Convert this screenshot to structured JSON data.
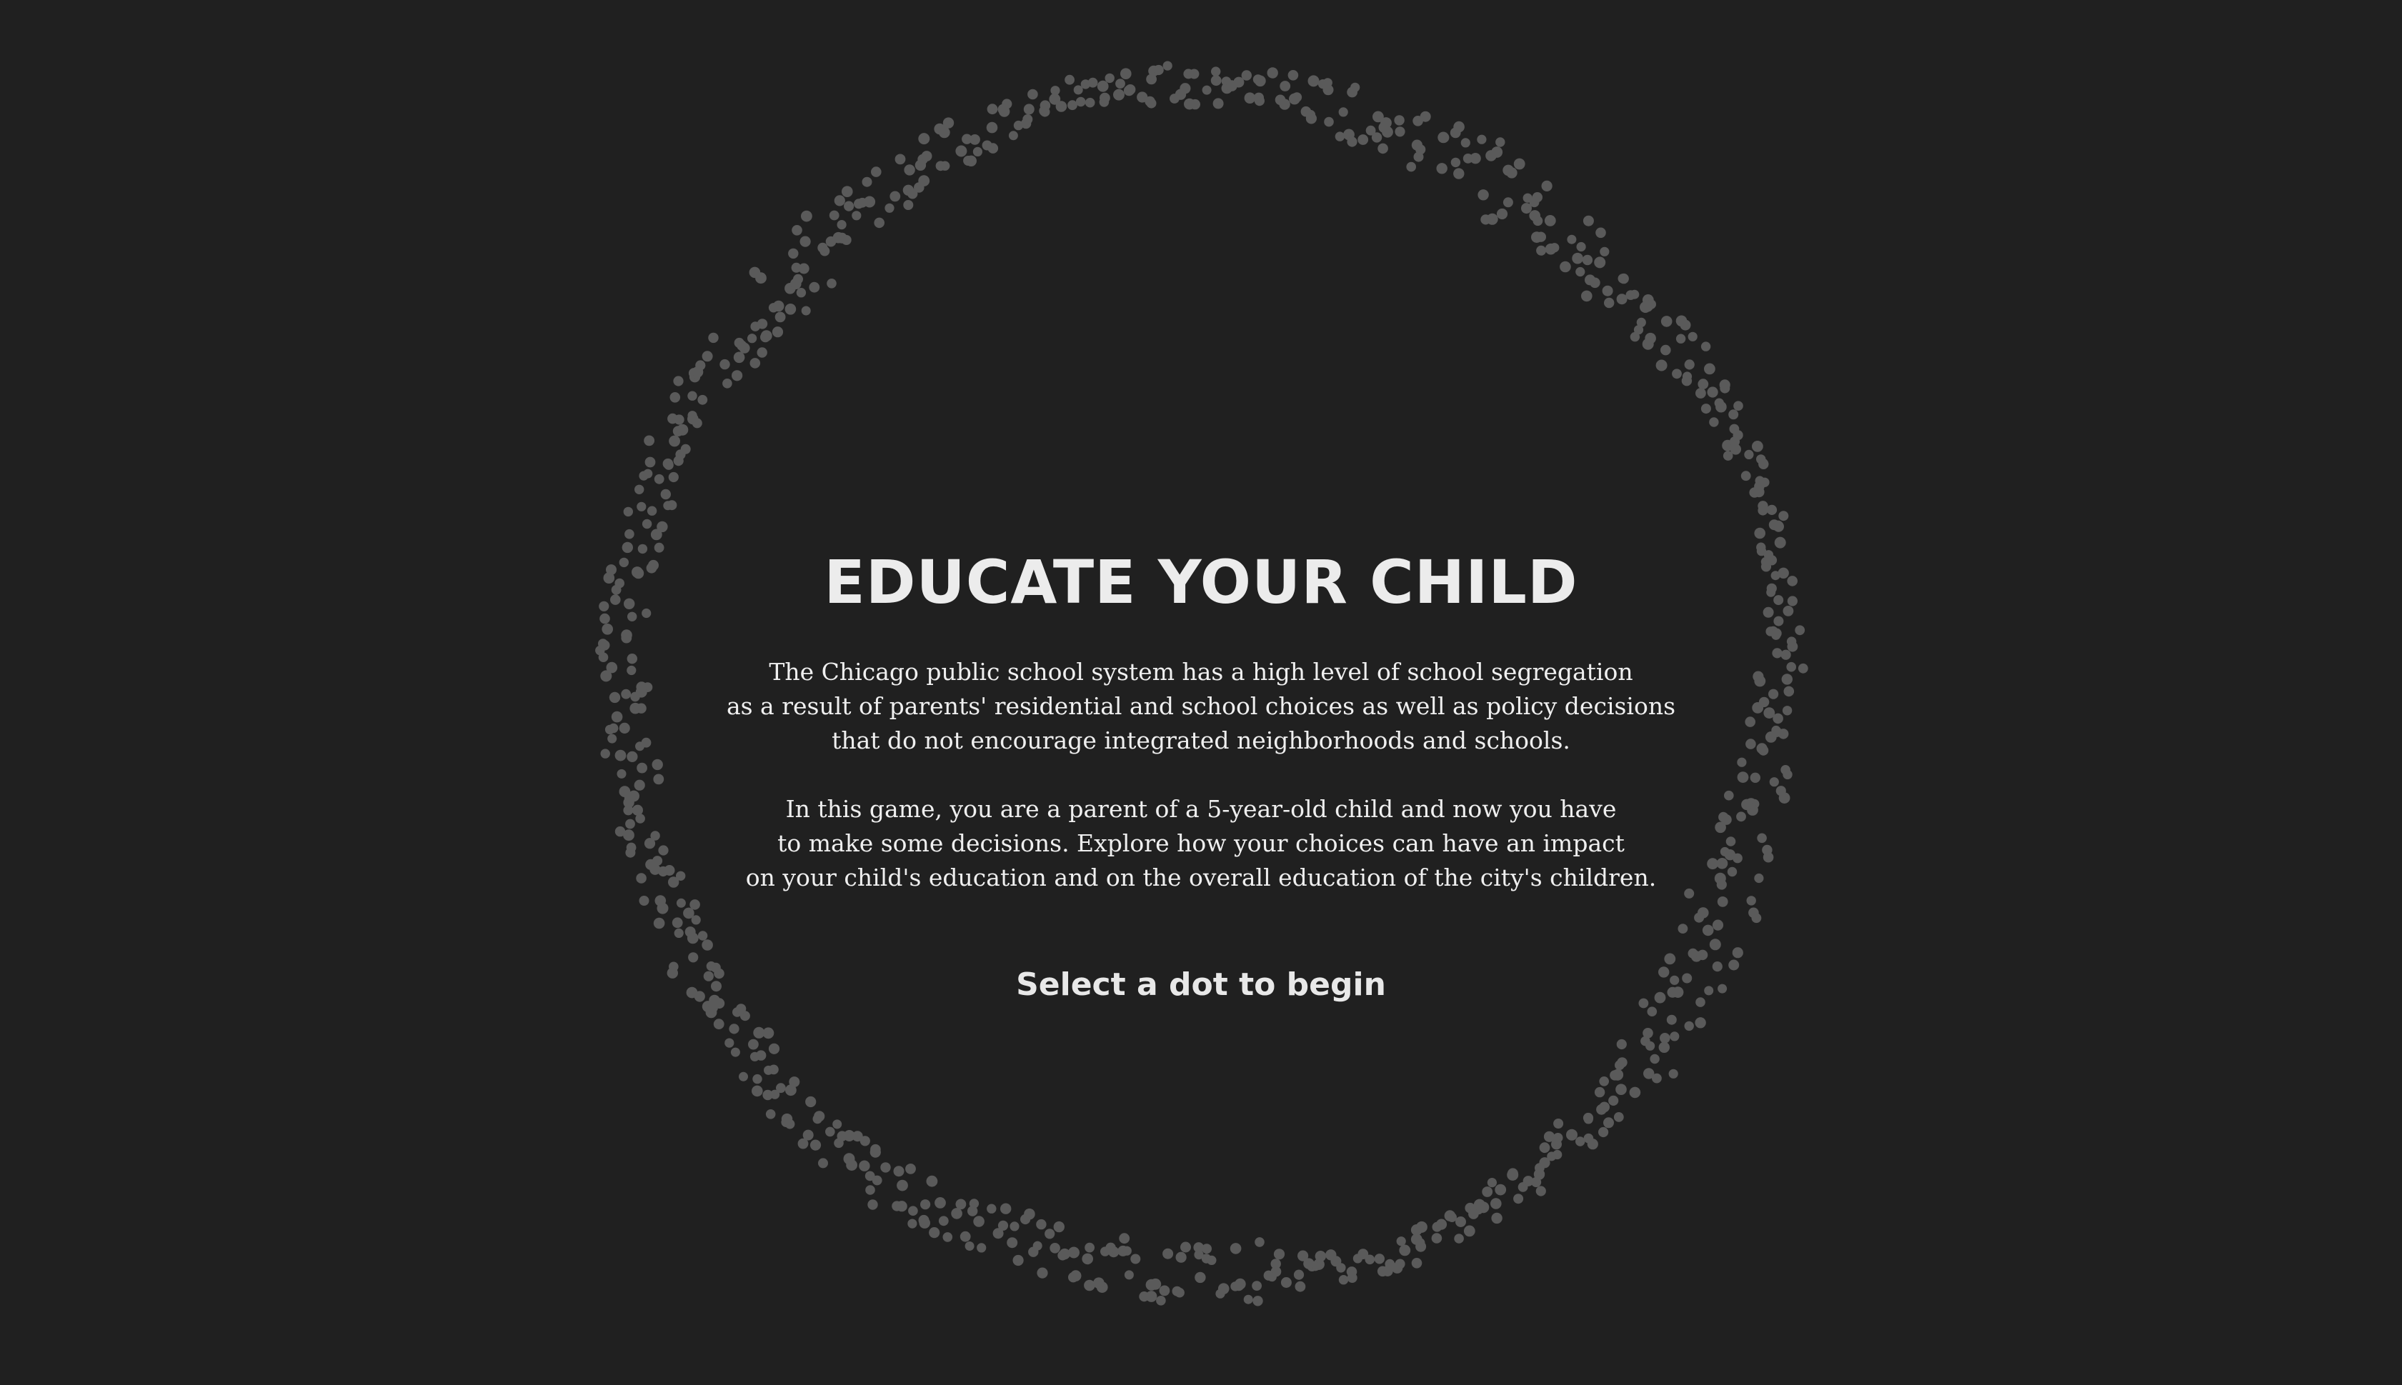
{
  "intro": {
    "title": "EDUCATE YOUR CHILD",
    "paragraph_1": "The Chicago public school system has a high level of school segregation\nas a result of parents' residential and school choices as well as policy decisions\nthat do not encourage integrated neighborhoods and schools.",
    "paragraph_2": "In this game, you are a parent of a 5-year-old child and now you have\nto make some decisions. Explore how your choices can have an impact\non your child's education and on the overall education of the city's children.",
    "call_to_action": "Select a dot to begin"
  },
  "dot_ring": {
    "shape": "ring of scattered selectable dots",
    "dot_color": "#5a5a5a",
    "dot_hover_color": "#9a9a9a"
  },
  "colors": {
    "background": "#202020",
    "text": "#efefef"
  }
}
